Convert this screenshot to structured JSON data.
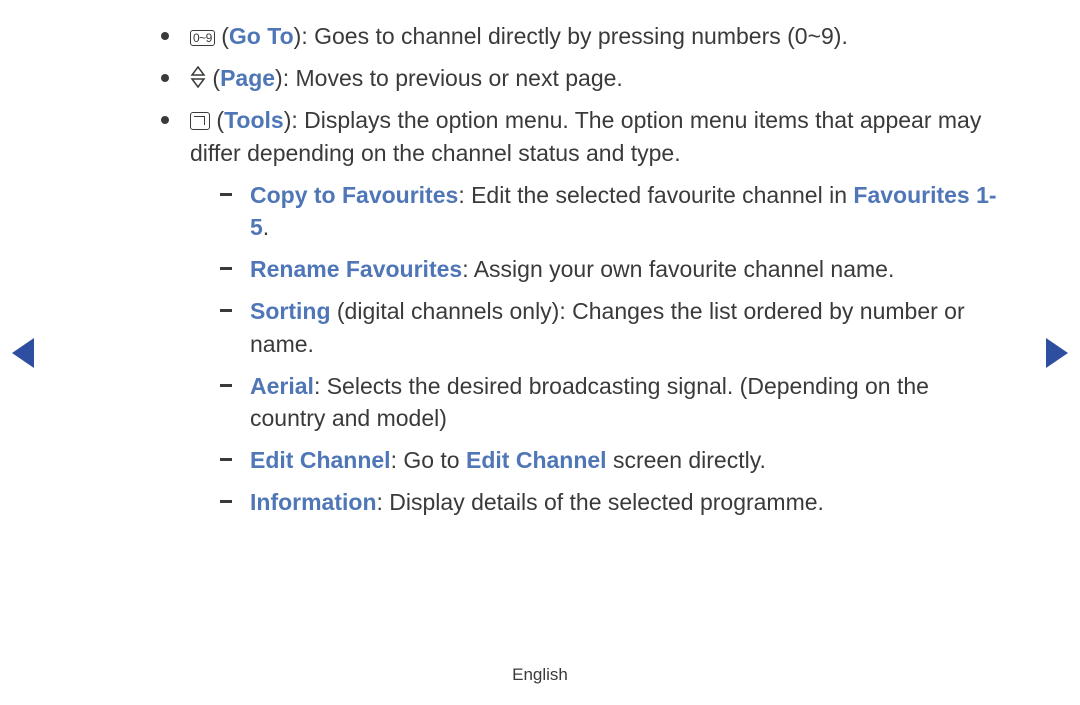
{
  "bullets": [
    {
      "icon": "0-9",
      "label": "Go To",
      "desc": "Goes to channel directly by pressing numbers (0~9)."
    },
    {
      "icon": "updown",
      "label": "Page",
      "desc": "Moves to previous or next page."
    },
    {
      "icon": "tools",
      "label": "Tools",
      "desc": "Displays the option menu. The option menu items that appear may differ depending on the channel status and type.",
      "subs": [
        {
          "label": "Copy to Favourites",
          "desc_a": ": Edit the selected favourite channel in ",
          "inline": "Favourites 1-5",
          "desc_b": "."
        },
        {
          "label": "Rename Favourites",
          "desc": ": Assign your own favourite channel name."
        },
        {
          "label": "Sorting",
          "note": " (digital channels only)",
          "desc": ": Changes the list ordered by number or name."
        },
        {
          "label": "Aerial",
          "desc": ": Selects the desired broadcasting signal. (Depending on the country and model)"
        },
        {
          "label": "Edit Channel",
          "desc_a": ": Go to ",
          "inline": "Edit Channel",
          "desc_b": " screen directly."
        },
        {
          "label": "Information",
          "desc": ": Display details of the selected programme."
        }
      ]
    }
  ],
  "icons": {
    "numbox": "0~9"
  },
  "footer": "English"
}
